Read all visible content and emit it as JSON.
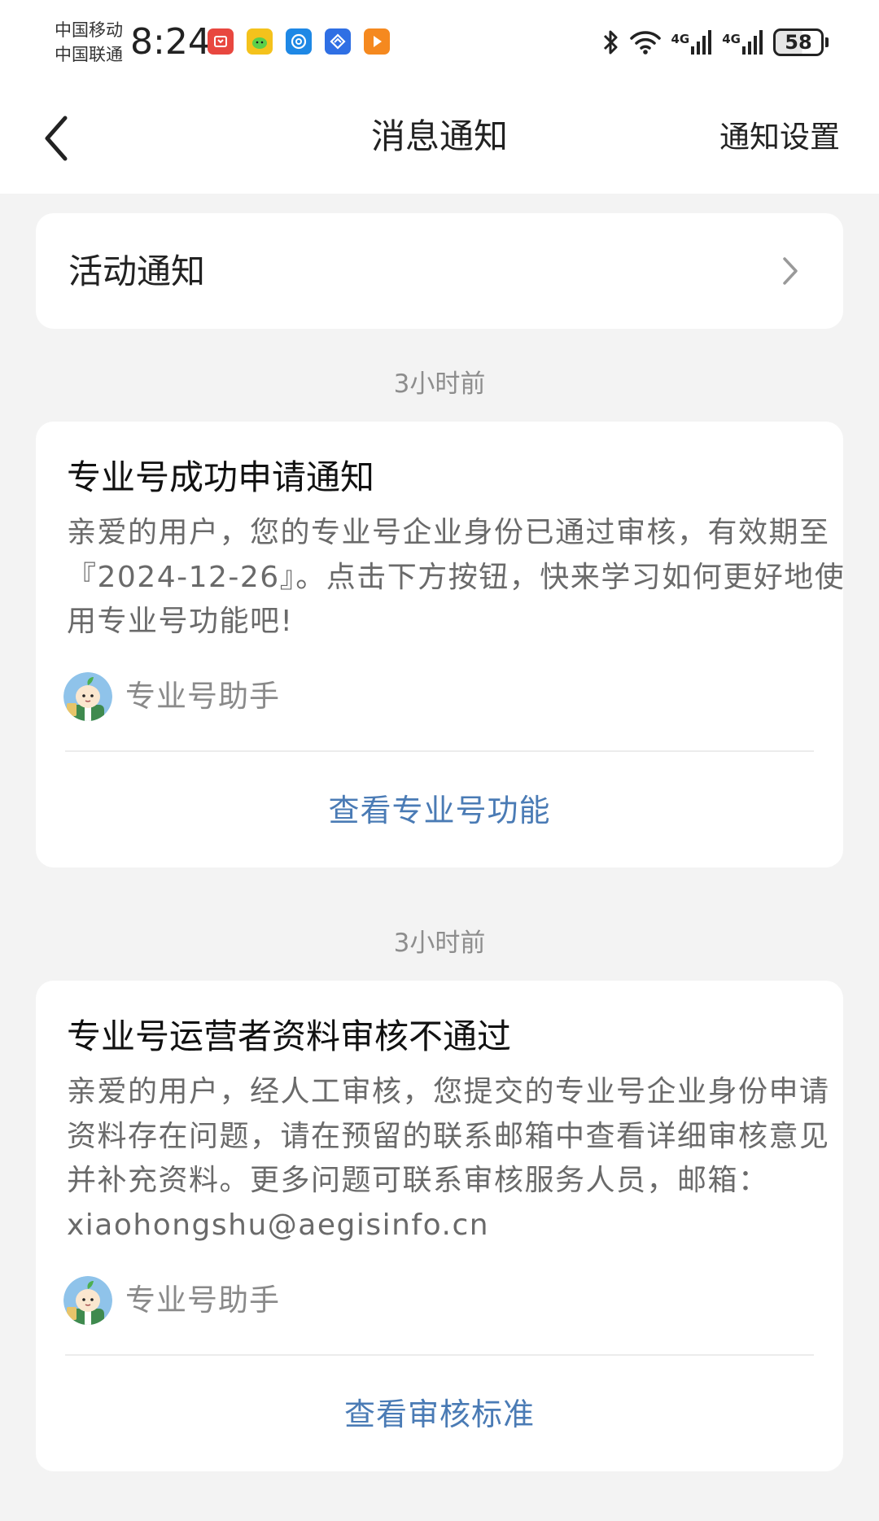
{
  "status_bar": {
    "carrier_1": "中国移动",
    "carrier_2": "中国联通",
    "time": "8:24",
    "network_1": "4G",
    "network_2": "4G",
    "battery": "58",
    "app_icons": [
      {
        "name": "red-app-icon",
        "color": "#e8473f"
      },
      {
        "name": "green-app-icon",
        "color": "#f4c21c"
      },
      {
        "name": "blue-at-app-icon",
        "color": "#1e88e5"
      },
      {
        "name": "blue-diamond-app-icon",
        "color": "#2f6fe4"
      },
      {
        "name": "orange-play-app-icon",
        "color": "#f5891f"
      }
    ]
  },
  "nav": {
    "title": "消息通知",
    "settings_label": "通知设置"
  },
  "activity": {
    "label": "活动通知"
  },
  "notifications": [
    {
      "time": "3小时前",
      "title": "专业号成功申请通知",
      "body": "亲爱的用户，您的专业号企业身份已通过审核，有效期至『2024-12-26』。点击下方按钮，快来学习如何更好地使用专业号功能吧!",
      "sender": "专业号助手",
      "action": "查看专业号功能"
    },
    {
      "time": "3小时前",
      "title": "专业号运营者资料审核不通过",
      "body": "亲爱的用户，经人工审核，您提交的专业号企业身份申请资料存在问题，请在预留的联系邮箱中查看详细审核意见并补充资料。更多问题可联系审核服务人员，邮箱：xiaohongshu@aegisinfo.cn",
      "sender": "专业号助手",
      "action": "查看审核标准"
    }
  ],
  "colors": {
    "background": "#f3f3f3",
    "card": "#ffffff",
    "link": "#4a7bb5",
    "muted_text": "#8a8a8a"
  }
}
